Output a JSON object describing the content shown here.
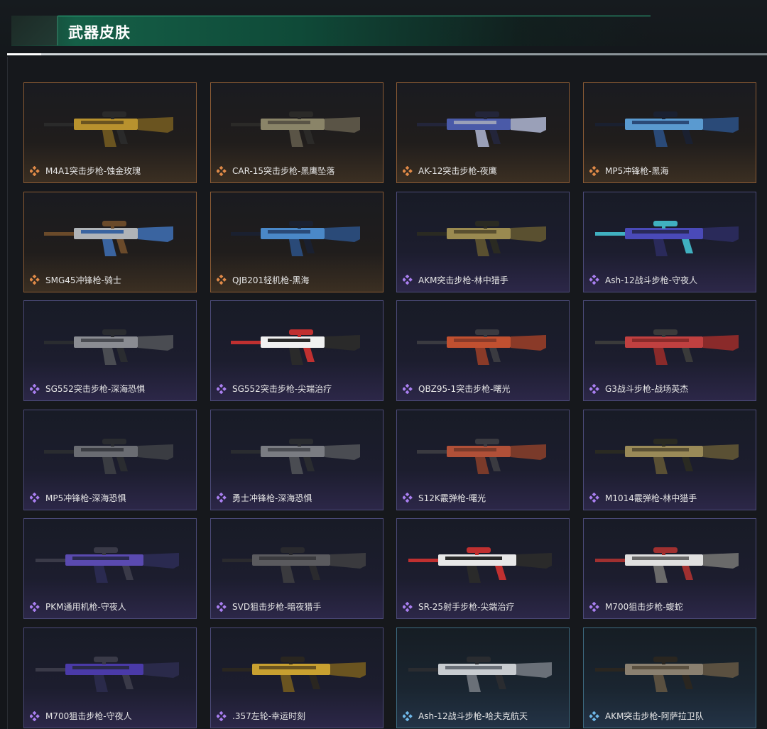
{
  "header": {
    "title": "武器皮肤"
  },
  "colors": {
    "orange": "#e08a48",
    "purple": "#a97ff0",
    "blue": "#6fb8e8",
    "accent": "#1f7a5a"
  },
  "skins": [
    {
      "label": "M4A1突击步枪-蚀金玫瑰",
      "rarity": "orange",
      "palette": [
        "#b8922e",
        "#6a5420",
        "#2a2a2a"
      ]
    },
    {
      "label": "CAR-15突击步枪-黑鹰坠落",
      "rarity": "orange",
      "palette": [
        "#8a8468",
        "#5a5446",
        "#2b2a28"
      ]
    },
    {
      "label": "AK-12突击步枪-夜鹰",
      "rarity": "orange",
      "palette": [
        "#4a5aa8",
        "#9aa0b8",
        "#23253a"
      ]
    },
    {
      "label": "MP5冲锋枪-黑海",
      "rarity": "orange",
      "palette": [
        "#5a9ad0",
        "#2a4a78",
        "#1a2030"
      ]
    },
    {
      "label": "SMG45冲锋枪-骑士",
      "rarity": "orange",
      "palette": [
        "#b0b4b8",
        "#3a64a0",
        "#6a4a2a"
      ]
    },
    {
      "label": "QJB201轻机枪-黑海",
      "rarity": "orange",
      "palette": [
        "#4a88c8",
        "#2a4a78",
        "#1a2030"
      ]
    },
    {
      "label": "AKM突击步枪-林中猎手",
      "rarity": "purple",
      "palette": [
        "#9a8a50",
        "#5a5030",
        "#2a2a22"
      ]
    },
    {
      "label": "Ash-12战斗步枪-守夜人",
      "rarity": "purple",
      "palette": [
        "#4a4ab8",
        "#2a2a5a",
        "#40b0c0"
      ]
    },
    {
      "label": "SG552突击步枪-深海恐惧",
      "rarity": "purple",
      "palette": [
        "#8a8c92",
        "#4a4c52",
        "#2a2c30"
      ]
    },
    {
      "label": "SG552突击步枪-尖端治疗",
      "rarity": "purple",
      "palette": [
        "#f0f0f0",
        "#2a2a2a",
        "#c03030"
      ]
    },
    {
      "label": "QBZ95-1突击步枪-曙光",
      "rarity": "purple",
      "palette": [
        "#c05030",
        "#8a3a28",
        "#3a3a40"
      ]
    },
    {
      "label": "G3战斗步枪-战场英杰",
      "rarity": "purple",
      "palette": [
        "#c04040",
        "#8a2a2a",
        "#3a3a3a"
      ]
    },
    {
      "label": "MP5冲锋枪-深海恐惧",
      "rarity": "purple",
      "palette": [
        "#6a6c72",
        "#3a3c42",
        "#2a2c30"
      ]
    },
    {
      "label": "勇士冲锋枪-深海恐惧",
      "rarity": "purple",
      "palette": [
        "#7a7c82",
        "#4a4c52",
        "#2a2c30"
      ]
    },
    {
      "label": "S12K霰弹枪-曙光",
      "rarity": "purple",
      "palette": [
        "#b05038",
        "#7a3a2a",
        "#3a3a40"
      ]
    },
    {
      "label": "M1014霰弹枪-林中猎手",
      "rarity": "purple",
      "palette": [
        "#9a8a58",
        "#5a5034",
        "#2a2a22"
      ]
    },
    {
      "label": "PKM通用机枪-守夜人",
      "rarity": "purple",
      "palette": [
        "#5a4ab0",
        "#2a2a50",
        "#3a3a48"
      ]
    },
    {
      "label": "SVD狙击步枪-暗夜猎手",
      "rarity": "purple",
      "palette": [
        "#5a5a5e",
        "#3a3a3e",
        "#2a2a2e"
      ]
    },
    {
      "label": "SR-25射手步枪-尖端治疗",
      "rarity": "purple",
      "palette": [
        "#e8e8e8",
        "#2a2a2a",
        "#c03030"
      ]
    },
    {
      "label": "M700狙击步枪-蝮蛇",
      "rarity": "purple",
      "palette": [
        "#e0e0e0",
        "#6a6a6a",
        "#a03030"
      ]
    },
    {
      "label": "M700狙击步枪-守夜人",
      "rarity": "purple",
      "palette": [
        "#4a3aa8",
        "#2a2a4a",
        "#3a3a48"
      ]
    },
    {
      "label": ".357左轮-幸运时刻",
      "rarity": "purple",
      "palette": [
        "#c8a030",
        "#6a5420",
        "#2a2620"
      ]
    },
    {
      "label": "Ash-12战斗步枪-哈夫克航天",
      "rarity": "blue",
      "palette": [
        "#c8ccd0",
        "#6a7078",
        "#2a2c30"
      ]
    },
    {
      "label": "AKM突击步枪-阿萨拉卫队",
      "rarity": "blue",
      "palette": [
        "#8a8070",
        "#5a5040",
        "#2a2620"
      ]
    }
  ]
}
